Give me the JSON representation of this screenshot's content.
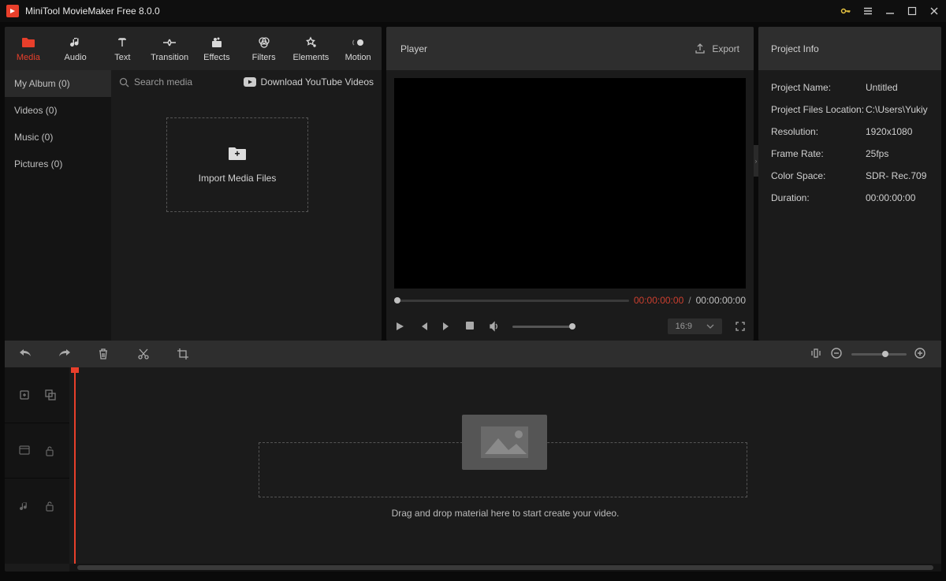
{
  "app": {
    "title": "MiniTool MovieMaker Free 8.0.0"
  },
  "tabs": [
    {
      "label": "Media",
      "icon": "folder"
    },
    {
      "label": "Audio",
      "icon": "music-note"
    },
    {
      "label": "Text",
      "icon": "text"
    },
    {
      "label": "Transition",
      "icon": "transition"
    },
    {
      "label": "Effects",
      "icon": "effects"
    },
    {
      "label": "Filters",
      "icon": "filters"
    },
    {
      "label": "Elements",
      "icon": "elements"
    },
    {
      "label": "Motion",
      "icon": "motion"
    }
  ],
  "media_sidebar": [
    {
      "label": "My Album (0)"
    },
    {
      "label": "Videos (0)"
    },
    {
      "label": "Music (0)"
    },
    {
      "label": "Pictures (0)"
    }
  ],
  "search": {
    "placeholder": "Search media"
  },
  "download_yt": "Download YouTube Videos",
  "import_label": "Import Media Files",
  "player": {
    "title": "Player",
    "export": "Export",
    "current_time": "00:00:00:00",
    "total_time": "00:00:00:00",
    "separator": "/",
    "ratio": "16:9"
  },
  "project_info": {
    "title": "Project Info",
    "rows": [
      {
        "label": "Project Name:",
        "value": "Untitled"
      },
      {
        "label": "Project Files Location:",
        "value": "C:\\Users\\Yukiy"
      },
      {
        "label": "Resolution:",
        "value": "1920x1080"
      },
      {
        "label": "Frame Rate:",
        "value": "25fps"
      },
      {
        "label": "Color Space:",
        "value": "SDR- Rec.709"
      },
      {
        "label": "Duration:",
        "value": "00:00:00:00"
      }
    ]
  },
  "timeline": {
    "drop_text": "Drag and drop material here to start create your video."
  }
}
